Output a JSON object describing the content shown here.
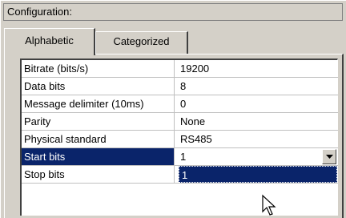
{
  "title": "Configuration:",
  "tabs": [
    {
      "label": "Alphabetic",
      "active": true
    },
    {
      "label": "Categorized",
      "active": false
    }
  ],
  "properties": [
    {
      "name": "Bitrate (bits/s)",
      "value": "19200"
    },
    {
      "name": "Data bits",
      "value": "8"
    },
    {
      "name": "Message delimiter (10ms)",
      "value": "0"
    },
    {
      "name": "Parity",
      "value": "None"
    },
    {
      "name": "Physical standard",
      "value": "RS485"
    },
    {
      "name": "Start bits",
      "value": "1"
    },
    {
      "name": "Stop bits",
      "value": "1"
    }
  ],
  "colors": {
    "selection": "#0a246a",
    "face": "#d4d0c8"
  },
  "icons": {
    "combo": "chevron-down-icon",
    "pointer": "arrow-cursor-icon"
  }
}
